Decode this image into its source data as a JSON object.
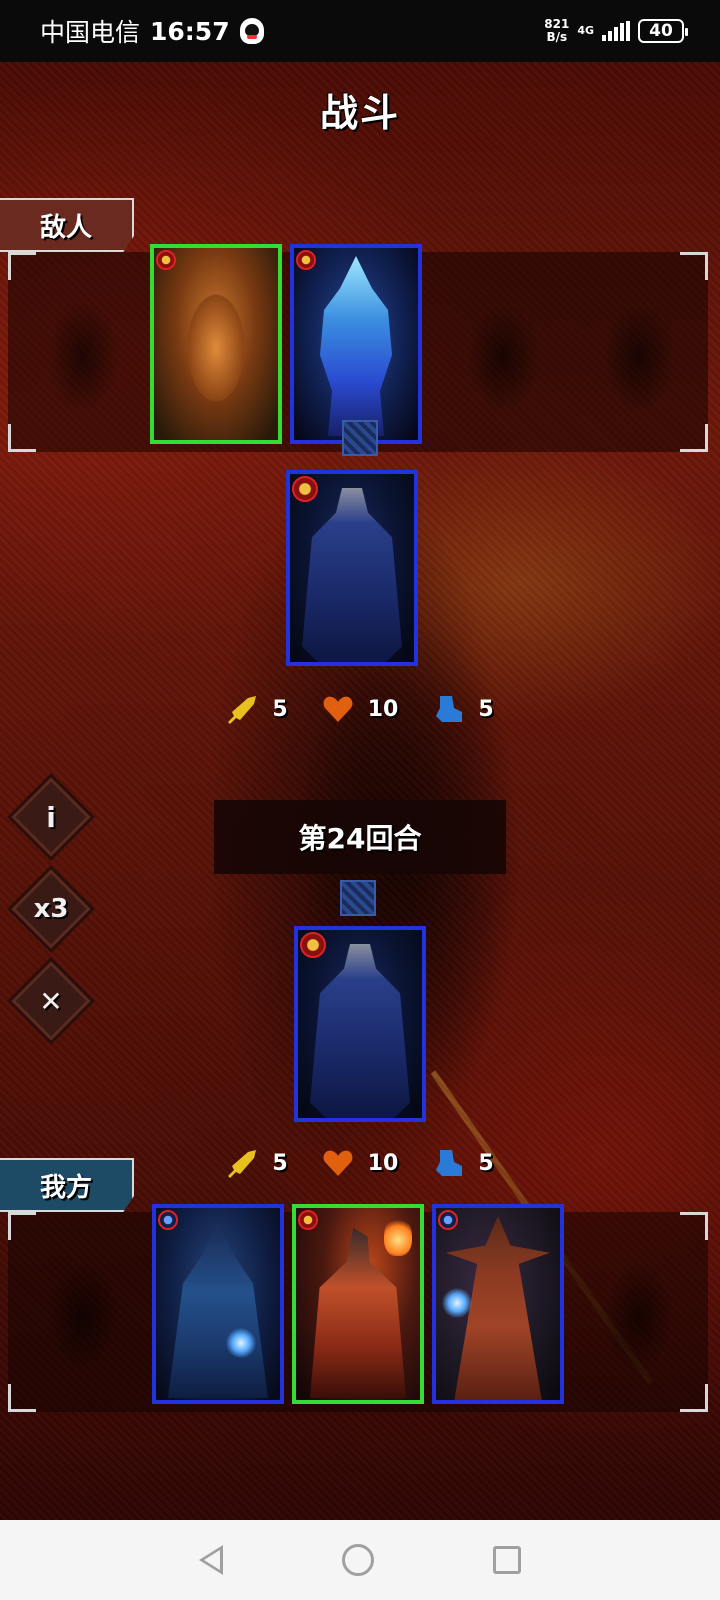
{
  "status_bar": {
    "carrier": "中国电信",
    "time": "16:57",
    "net_speed_value": "821",
    "net_speed_unit": "B/s",
    "network_type": "4G",
    "battery": "40",
    "app_icon": "qq-icon"
  },
  "header": {
    "title": "战斗"
  },
  "enemy": {
    "tag_label": "敌人",
    "tag_color": "#6a2a1f",
    "cards": [
      {
        "art": "beast",
        "badge": "fire",
        "active": true
      },
      {
        "art": "crystal-knight",
        "badge": "fire",
        "active": false
      }
    ],
    "combat_card": {
      "art": "reaper",
      "badge": "fire"
    },
    "stats": {
      "attack": "5",
      "health": "10",
      "speed": "5"
    }
  },
  "turn": {
    "label": "第24回合"
  },
  "ally": {
    "tag_label": "我方",
    "tag_color": "#1d4b66",
    "combat_card": {
      "art": "reaper",
      "badge": "fire"
    },
    "stats": {
      "attack": "5",
      "health": "10",
      "speed": "5"
    },
    "cards": [
      {
        "art": "water-mage",
        "badge": "water",
        "active": false
      },
      {
        "art": "plague-doctor",
        "badge": "fire",
        "active": true
      },
      {
        "art": "red-wizard",
        "badge": "water",
        "active": false
      }
    ]
  },
  "side_buttons": {
    "info_label": "i",
    "speed_label": "x3",
    "close_label": "✕"
  },
  "colors": {
    "active_card_border": "#33dd33",
    "card_border": "#2233dd",
    "attack_icon": "#e8c020",
    "health_icon": "#e06010",
    "speed_icon": "#2a7ad8"
  },
  "icons": {
    "attack": "sword-icon",
    "health": "heart-icon",
    "speed": "boot-icon"
  }
}
